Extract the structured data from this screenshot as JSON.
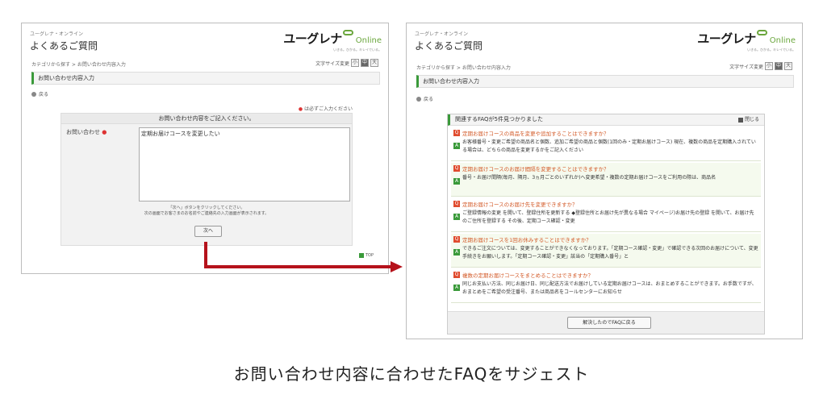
{
  "left": {
    "subtitle": "ユーグレナ・オンライン",
    "title": "よくあるご質問",
    "logo": {
      "main": "ユーグレナ",
      "online": "Online",
      "tagline": "いきる。ひかる。キレイでいる。"
    },
    "breadcrumb": "カテゴリから探す > お問い合わせ内容入力",
    "font_size_label": "文字サイズ変更",
    "font_size_buttons": [
      "小",
      "中",
      "大"
    ],
    "section_title": "お問い合わせ内容入力",
    "back": "戻る",
    "required_note_mark": "●",
    "required_note": "は必ずご入力ください",
    "form_heading": "お問い合わせ内容をご記入ください。",
    "form_label": "お問い合わせ",
    "form_label_mark": "●",
    "form_value": "定期お届けコースを変更したい",
    "form_note_line1": "「次へ」ボタンをクリックしてください。",
    "form_note_line2": "次の画面でお客さまのお名前やご連絡先の入力画面が表示されます。",
    "next_button": "次へ",
    "top_link": "TOP"
  },
  "right": {
    "subtitle": "ユーグレナ・オンライン",
    "title": "よくあるご質問",
    "logo": {
      "main": "ユーグレナ",
      "online": "Online",
      "tagline": "いきる。ひかる。キレイでいる。"
    },
    "breadcrumb": "カテゴリから探す > お問い合わせ内容入力",
    "font_size_label": "文字サイズ変更",
    "font_size_buttons": [
      "小",
      "中",
      "大"
    ],
    "section_title": "お問い合わせ内容入力",
    "back": "戻る",
    "faq_heading": "関連するFAQが5件見つかりました",
    "close": "閉じる",
    "q_icon": "Q",
    "a_icon": "A",
    "items": [
      {
        "q": "定期お届けコースの商品を変更や追加することはできますか？",
        "a": "お客様番号・変更ご希望の商品名と個数、追加ご希望の商品と個数(1回のみ・定期お届けコース) 現在、複数の商品を定期購入されている場合は、どちらの商品を変更するかをご記入ください"
      },
      {
        "q": "定期お届けコースのお届け間隔を変更することはできますか？",
        "a": "番号・お届け間隔(毎月、隔月、3ヵ月ごとのいずれか)へ変更希望・複数の定期お届けコースをご利用の際は、商品名"
      },
      {
        "q": "定期お届けコースのお届け先を変更できますか？",
        "a": "ご登録情報の変更 を開いて、登録住所を更新する ◆登録住所とお届け先が異なる場合 マイページ)お届け先の登録 を開いて、お届け先のご住所を登録する その後、定期コース確認・変更"
      },
      {
        "q": "定期お届けコースを1回お休みすることはできますか？",
        "a": "できるご注文については、変更することができなくなっております。「定期コース確認・変更」で確認できる次回のお届けについて、変更手続きをお願いします。「定期コース確認・変更」該当の「定期購入番号」と"
      },
      {
        "q": "複数の定期お届けコースをまとめることはできますか？",
        "a": "同じお支払い方法、同じお届け日、同じ配送方法でお届けしている定期お届けコースは、おまとめすることができます。お手数ですが、おまとめをご希望の受注番号、または商品名をコールセンターにお知らせ"
      }
    ],
    "solved_button": "解決したのでFAQに戻る"
  },
  "caption": "お問い合わせ内容に合わせたFAQをサジェスト",
  "colors": {
    "accent_green": "#3a9a3a",
    "arrow_red": "#b5121b",
    "question_orange": "#d35a28"
  }
}
